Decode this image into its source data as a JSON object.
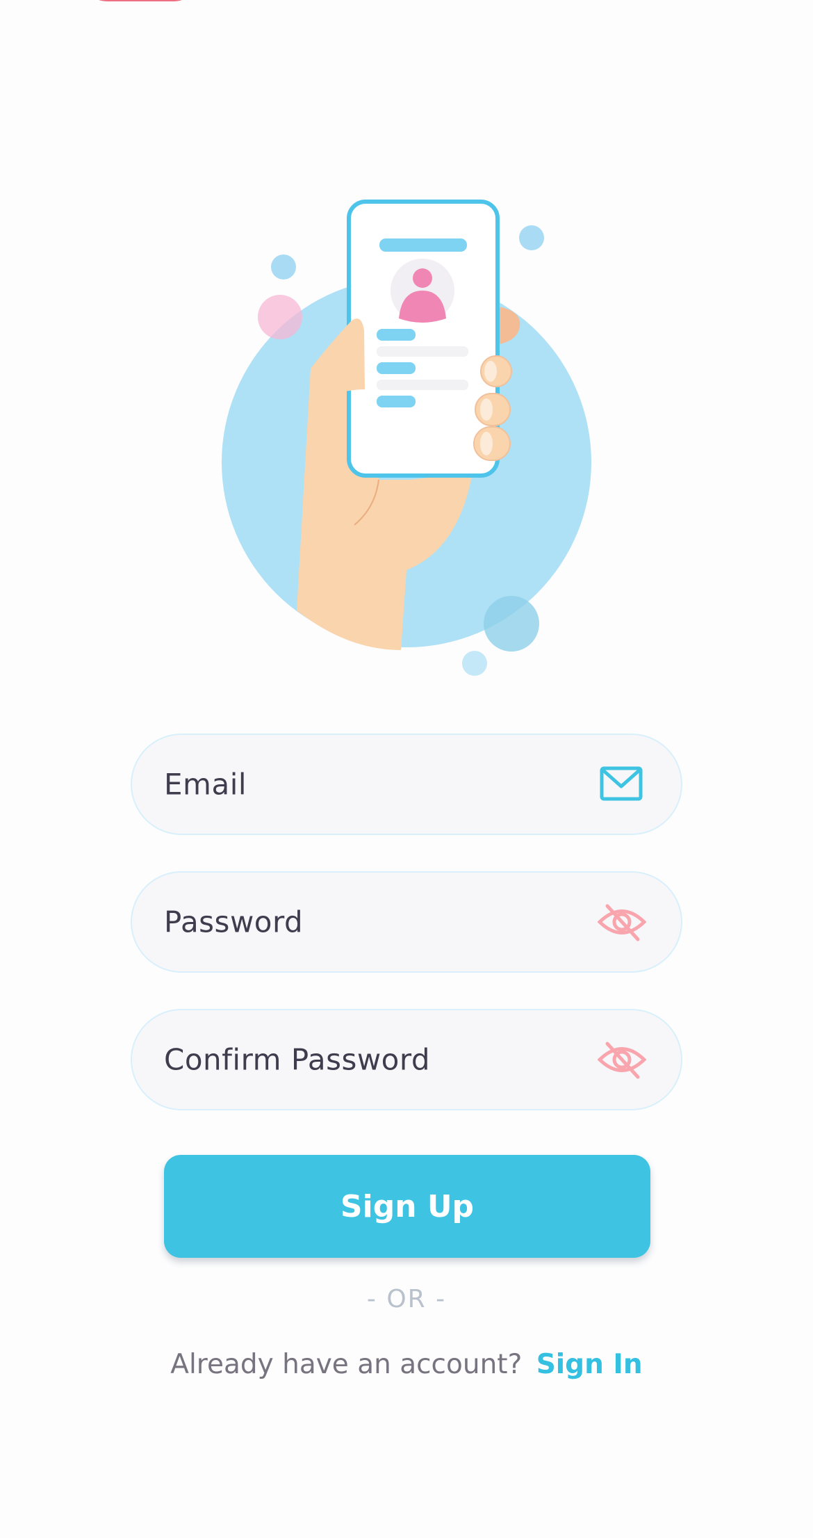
{
  "form": {
    "email_label": "Email",
    "password_label": "Password",
    "confirm_password_label": "Confirm Password"
  },
  "actions": {
    "signup_label": "Sign Up",
    "divider_label": "- OR -",
    "signin_prompt": "Already have an account?",
    "signin_link": "Sign In"
  },
  "icons": {
    "email": "envelope-icon",
    "password_toggle": "eye-off-icon",
    "confirm_password_toggle": "eye-off-icon"
  },
  "colors": {
    "primary": "#3ec4e2",
    "link": "#35bfe0",
    "visibility_icon": "#f8a5ad",
    "field_background": "#f7f7fa",
    "field_border": "#d8f0fb"
  }
}
